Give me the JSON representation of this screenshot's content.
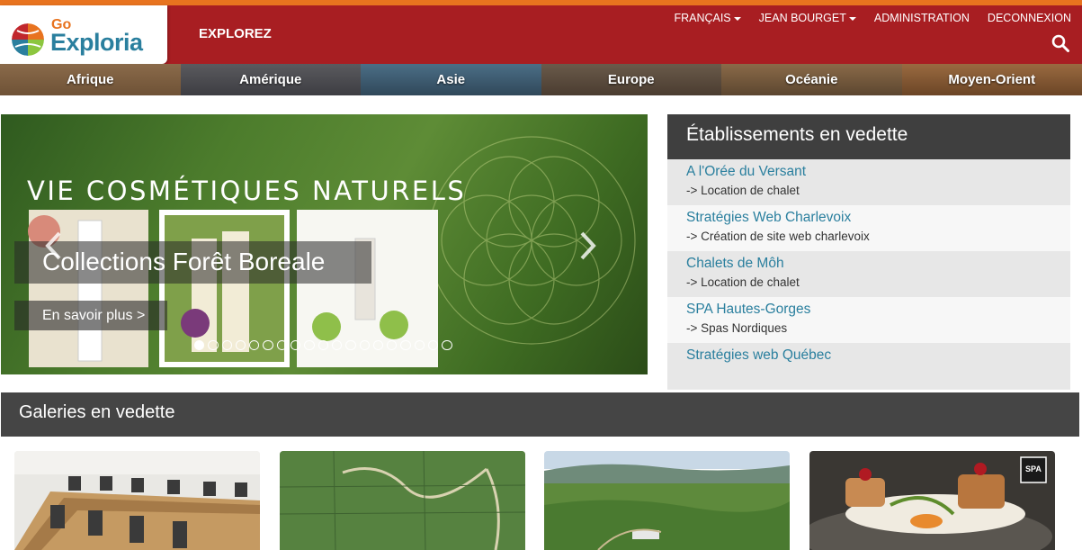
{
  "header": {
    "logo": {
      "go": "Go",
      "name": "Exploria"
    },
    "explore_label": "EXPLOREZ",
    "nav": {
      "language": "FRANÇAIS",
      "user": "JEAN BOURGET",
      "admin": "ADMINISTRATION",
      "logout": "DECONNEXION"
    }
  },
  "regions": [
    "Afrique",
    "Amérique",
    "Asie",
    "Europe",
    "Océanie",
    "Moyen-Orient"
  ],
  "slider": {
    "banner_text": "VIE COSMÉTIQUES NATURELS",
    "caption": "Collections Forêt Boreale",
    "more_label": "En savoir plus >",
    "dot_count": 19,
    "active_dot": 0
  },
  "featured": {
    "title": "Établissements en vedette",
    "items": [
      {
        "name": "A l'Orée du Versant",
        "category": "-> Location de chalet"
      },
      {
        "name": "Stratégies Web Charlevoix",
        "category": "-> Création de site web charlevoix"
      },
      {
        "name": "Chalets de Môh",
        "category": "-> Location de chalet"
      },
      {
        "name": "SPA Hautes-Gorges",
        "category": "-> Spas Nordiques"
      },
      {
        "name": "Stratégies web Québec",
        "category": ""
      }
    ]
  },
  "galleries": {
    "title": "Galeries en vedette",
    "badge": "SPA"
  },
  "colors": {
    "header_red": "#a81e22",
    "accent_orange": "#e8731f",
    "link_teal": "#2a7f9e",
    "dark_bar": "#454545"
  }
}
